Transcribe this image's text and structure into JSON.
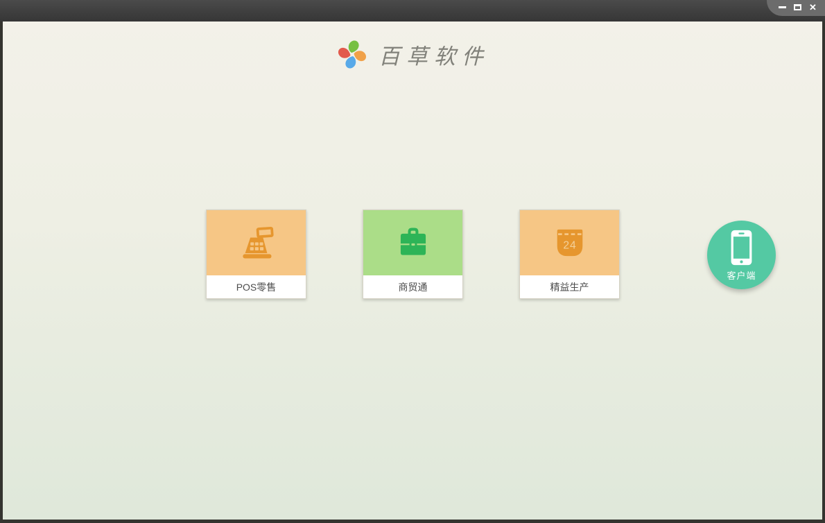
{
  "window": {
    "controls": {
      "minimize_label": "minimize",
      "maximize_label": "maximize",
      "close_label": "close",
      "close_glyph": "✕"
    },
    "titlebar_color_top": "#4b4b4b",
    "titlebar_color_bottom": "#363636",
    "frame_color": "#34342f"
  },
  "header": {
    "app_name": "百草软件"
  },
  "logo": {
    "icon": "pinwheel-icon",
    "petals": {
      "top": "#77c043",
      "right": "#f0a149",
      "bottom": "#58a9e8",
      "left": "#e25a4d"
    }
  },
  "products": [
    {
      "label": "POS零售",
      "icon": "cash-register-icon",
      "tile_color": "#f6c685",
      "icon_color": "#e6962e"
    },
    {
      "label": "商贸通",
      "icon": "briefcase-icon",
      "tile_color": "#abdd88",
      "icon_color": "#2db457"
    },
    {
      "label": "精益生产",
      "icon": "calendar-icon",
      "tile_color": "#f6c685",
      "icon_color": "#e6962e",
      "day": "24"
    }
  ],
  "client": {
    "label": "客户端",
    "icon": "smartphone-icon",
    "color": "#54c9a3"
  },
  "background": {
    "top": "#f3f1e9",
    "bottom": "#dfe8da"
  }
}
